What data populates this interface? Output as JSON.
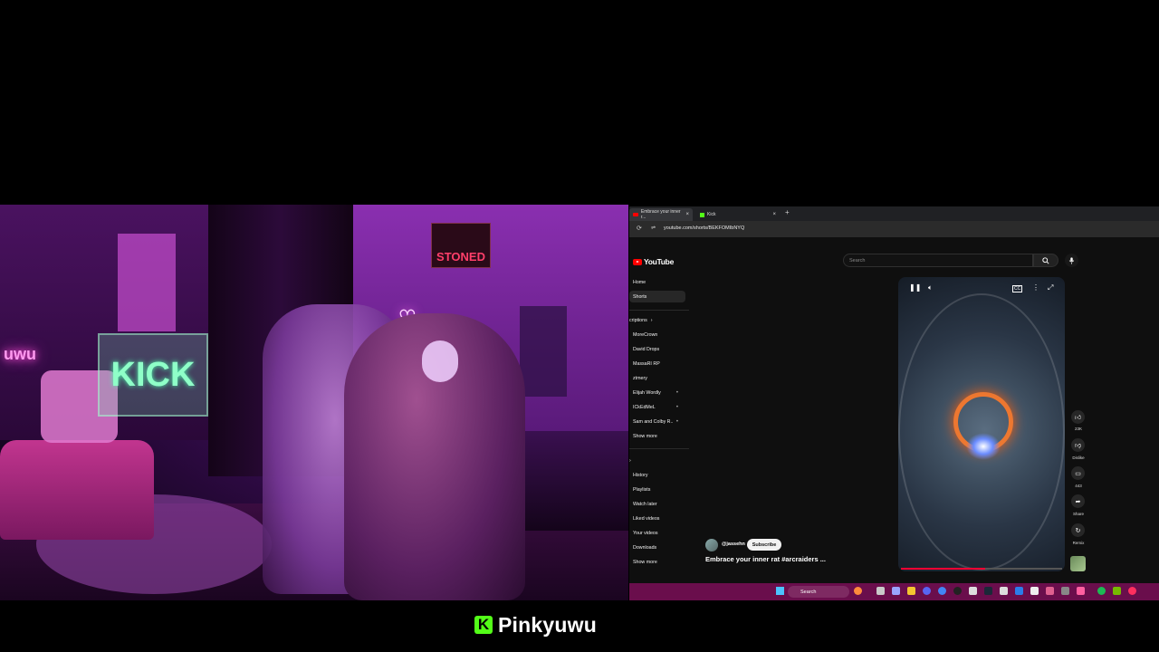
{
  "browser": {
    "tabs": [
      {
        "label": "Embrace your inner r...",
        "icon": "youtube-icon"
      },
      {
        "label": "Kick",
        "icon": "kick-icon"
      }
    ],
    "url": "youtube.com/shorts/BEKFOMIbNYQ"
  },
  "youtube": {
    "logo_text": "YouTube",
    "search_placeholder": "Search",
    "sidebar": {
      "items": [
        {
          "label": "Home",
          "active": false
        },
        {
          "label": "Shorts",
          "active": true
        }
      ],
      "subscriptions_header": "criptions",
      "subscriptions": [
        {
          "label": "MoreCrown",
          "live": false
        },
        {
          "label": "David Drops",
          "live": false
        },
        {
          "label": "MassaRI RP",
          "live": false
        },
        {
          "label": "ztmery",
          "live": false
        },
        {
          "label": "Elijah Wordly",
          "live": true
        },
        {
          "label": "ICkEdMeL",
          "live": true
        },
        {
          "label": "Sam and Colby R..",
          "live": true
        }
      ],
      "subs_show_more": "Show more",
      "you_items": [
        {
          "label": "History"
        },
        {
          "label": "Playlists"
        },
        {
          "label": "Watch later"
        },
        {
          "label": "Liked videos"
        },
        {
          "label": "Your videos"
        },
        {
          "label": "Downloads"
        }
      ],
      "you_show_more": "Show more"
    },
    "short": {
      "channel": "@jassehn",
      "subscribe_label": "Subscribe",
      "title": "Embrace your inner rat #arcraiders ...",
      "progress": 0.52
    },
    "actions": {
      "like_count": "23K",
      "dislike_label": "Dislike",
      "comment_count": "443",
      "share_label": "Share",
      "remix_label": "Remix"
    }
  },
  "taskbar": {
    "search_label": "Search"
  },
  "cam": {
    "kick_sign": "KICK",
    "stoned_sign": "STONED",
    "neon_left": "uwu"
  },
  "overlay": {
    "platform_badge": "K",
    "streamer_name": "Pinkyuwu"
  }
}
